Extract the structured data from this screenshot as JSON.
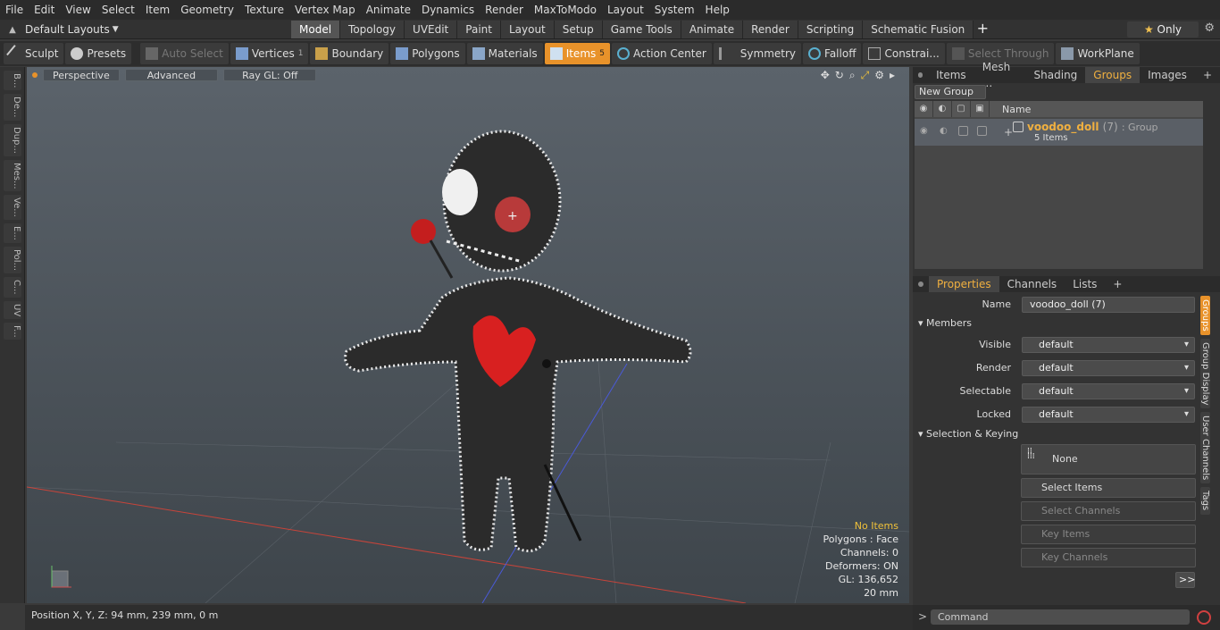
{
  "menu": [
    "File",
    "Edit",
    "View",
    "Select",
    "Item",
    "Geometry",
    "Texture",
    "Vertex Map",
    "Animate",
    "Dynamics",
    "Render",
    "MaxToModo",
    "Layout",
    "System",
    "Help"
  ],
  "layout_dropdown": "Default Layouts",
  "mode_tabs": [
    {
      "label": "Model",
      "active": true
    },
    {
      "label": "Topology",
      "active": false
    },
    {
      "label": "UVEdit",
      "active": false
    },
    {
      "label": "Paint",
      "active": false
    },
    {
      "label": "Layout",
      "active": false
    },
    {
      "label": "Setup",
      "active": false
    },
    {
      "label": "Game Tools",
      "active": false
    },
    {
      "label": "Animate",
      "active": false
    },
    {
      "label": "Render",
      "active": false
    },
    {
      "label": "Scripting",
      "active": false
    },
    {
      "label": "Schematic Fusion",
      "active": false
    }
  ],
  "only_label": "Only",
  "toolbar": {
    "sculpt": "Sculpt",
    "presets": "Presets",
    "auto_select": "Auto Select",
    "vertices": "Vertices",
    "vertices_count": "1",
    "boundary": "Boundary",
    "polygons": "Polygons",
    "materials": "Materials",
    "items": "Items",
    "items_count": "5",
    "action_center": "Action Center",
    "symmetry": "Symmetry",
    "falloff": "Falloff",
    "constraints": "Constrai...",
    "select_through": "Select Through",
    "workplane": "WorkPlane"
  },
  "left_tabs": [
    "B...",
    "De...",
    "Dup...",
    "Mes...",
    "Ve...",
    "E...",
    "Pol...",
    "C...",
    "UV",
    "F..."
  ],
  "viewport": {
    "perspective": "Perspective",
    "advanced": "Advanced",
    "raygl": "Ray GL: Off"
  },
  "stats": {
    "items": "No Items",
    "polygons": "Polygons : Face",
    "channels": "Channels: 0",
    "deformers": "Deformers: ON",
    "gl": "GL: 136,652",
    "scale": "20 mm"
  },
  "status": "Position X, Y, Z:  94 mm, 239 mm, 0 m",
  "right_tabs": [
    {
      "label": "Items",
      "active": false
    },
    {
      "label": "Mesh ...",
      "active": false
    },
    {
      "label": "Shading",
      "active": false
    },
    {
      "label": "Groups",
      "active": true
    },
    {
      "label": "Images",
      "active": false
    }
  ],
  "groups": {
    "new_group": "New Group",
    "col_name": "Name",
    "row_name": "voodoo_doll",
    "row_count": "(7)",
    "row_type": ": Group",
    "row_sub": "5 Items"
  },
  "prop_tabs": [
    {
      "label": "Properties",
      "active": true
    },
    {
      "label": "Channels",
      "active": false
    },
    {
      "label": "Lists",
      "active": false
    }
  ],
  "props": {
    "name_label": "Name",
    "name_value": "voodoo_doll (7)",
    "members": "Members",
    "visible_label": "Visible",
    "visible": "default",
    "render_label": "Render",
    "render": "default",
    "selectable_label": "Selectable",
    "selectable": "default",
    "locked_label": "Locked",
    "locked": "default",
    "selection_keying": "Selection & Keying",
    "none": "None",
    "select_items": "Select Items",
    "select_channels": "Select Channels",
    "key_items": "Key Items",
    "key_channels": "Key Channels",
    "more": ">>"
  },
  "side_vtabs": [
    {
      "label": "Groups",
      "active": true
    },
    {
      "label": "Group Display",
      "active": false
    },
    {
      "label": "User Channels",
      "active": false
    },
    {
      "label": "Tags",
      "active": false
    }
  ],
  "command_placeholder": "Command"
}
